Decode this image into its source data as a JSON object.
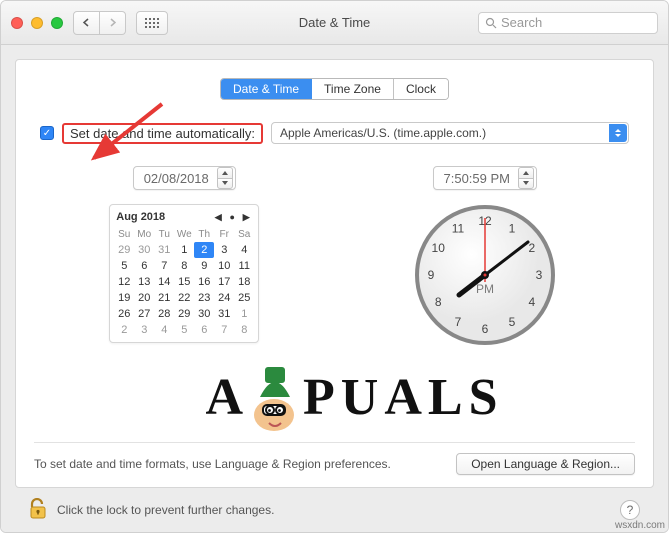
{
  "window": {
    "title": "Date & Time"
  },
  "toolbar": {
    "search_placeholder": "Search"
  },
  "tabs": {
    "date_time": "Date & Time",
    "time_zone": "Time Zone",
    "clock": "Clock",
    "active": "date_time"
  },
  "auto": {
    "checked": true,
    "label": "Set date and time automatically:",
    "server": "Apple Americas/U.S. (time.apple.com.)"
  },
  "date_field": "02/08/2018",
  "time_field": "7:50:59 PM",
  "calendar": {
    "title": "Aug 2018",
    "dow": [
      "Su",
      "Mo",
      "Tu",
      "We",
      "Th",
      "Fr",
      "Sa"
    ],
    "leading": [
      "29",
      "30",
      "31"
    ],
    "days": [
      "1",
      "2",
      "3",
      "4",
      "5",
      "6",
      "7",
      "8",
      "9",
      "10",
      "11",
      "12",
      "13",
      "14",
      "15",
      "16",
      "17",
      "18",
      "19",
      "20",
      "21",
      "22",
      "23",
      "24",
      "25",
      "26",
      "27",
      "28",
      "29",
      "30",
      "31"
    ],
    "trailing": [
      "1",
      "2",
      "3",
      "4",
      "5",
      "6",
      "7",
      "8"
    ],
    "selected": "2"
  },
  "clock": {
    "pm_label": "PM",
    "hours": [
      "12",
      "1",
      "2",
      "3",
      "4",
      "5",
      "6",
      "7",
      "8",
      "9",
      "10",
      "11"
    ]
  },
  "footer": {
    "hint": "To set date and time formats, use Language & Region preferences.",
    "open_button": "Open Language & Region..."
  },
  "lock": {
    "text": "Click the lock to prevent further changes."
  },
  "watermark": {
    "brand_left": "A",
    "brand_right": "PUALS"
  },
  "source": "wsxdn.com"
}
